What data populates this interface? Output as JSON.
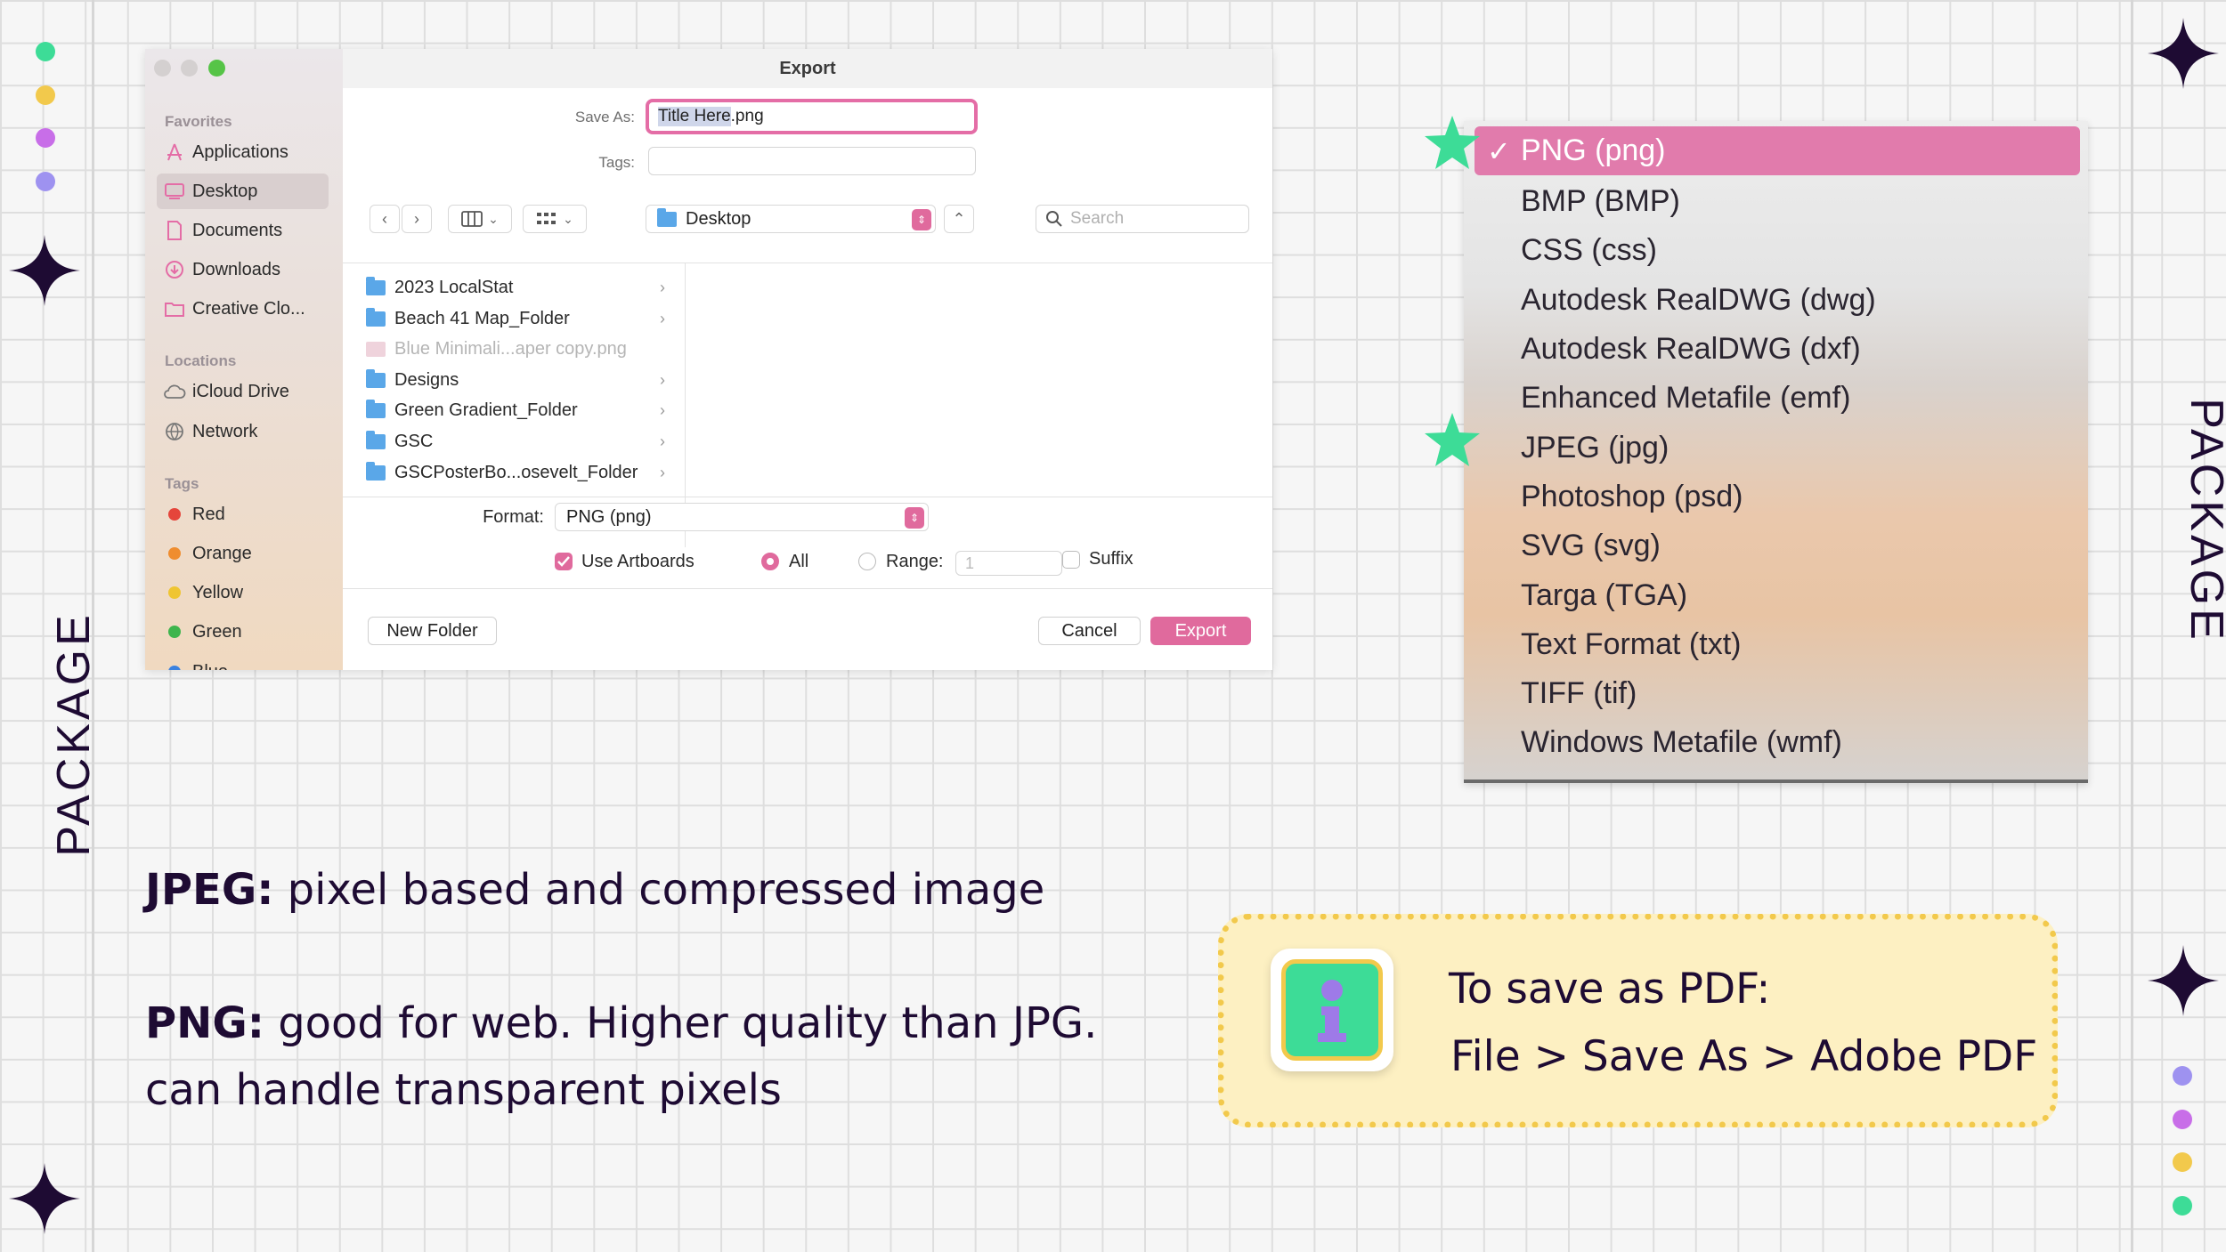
{
  "side_label": "PACKAGE",
  "dialog": {
    "title": "Export",
    "sidebar": {
      "favorites_heading": "Favorites",
      "favorites": [
        {
          "label": "Applications",
          "icon": "applications-icon"
        },
        {
          "label": "Desktop",
          "icon": "desktop-icon"
        },
        {
          "label": "Documents",
          "icon": "document-icon"
        },
        {
          "label": "Downloads",
          "icon": "download-icon"
        },
        {
          "label": "Creative Clo...",
          "icon": "folder-icon"
        }
      ],
      "locations_heading": "Locations",
      "locations": [
        {
          "label": "iCloud Drive",
          "icon": "cloud-icon"
        },
        {
          "label": "Network",
          "icon": "globe-icon"
        }
      ],
      "tags_heading": "Tags",
      "tags": [
        {
          "label": "Red",
          "color": "#e5453b"
        },
        {
          "label": "Orange",
          "color": "#ef8d2f"
        },
        {
          "label": "Yellow",
          "color": "#efc532"
        },
        {
          "label": "Green",
          "color": "#3eb54d"
        },
        {
          "label": "Blue",
          "color": "#3b82e0"
        }
      ]
    },
    "save_as_label": "Save As:",
    "save_as_highlight": "Title Here",
    "save_as_ext": ".png",
    "tags_label": "Tags:",
    "location": "Desktop",
    "search_placeholder": "Search",
    "files": [
      {
        "name": "2023 LocalStat",
        "type": "folder",
        "has_children": true
      },
      {
        "name": "Beach 41 Map_Folder",
        "type": "folder",
        "has_children": true
      },
      {
        "name": "Blue Minimali...aper copy.png",
        "type": "file",
        "has_children": false
      },
      {
        "name": "Designs",
        "type": "folder",
        "has_children": true
      },
      {
        "name": "Green Gradient_Folder",
        "type": "folder",
        "has_children": true
      },
      {
        "name": "GSC",
        "type": "folder",
        "has_children": true
      },
      {
        "name": "GSCPosterBo...osevelt_Folder",
        "type": "folder",
        "has_children": true
      }
    ],
    "format_label": "Format:",
    "format_value": "PNG (png)",
    "use_artboards": "Use Artboards",
    "use_artboards_checked": true,
    "all_label": "All",
    "range_label": "Range:",
    "range_value": "1",
    "suffix_label": "Suffix",
    "new_folder": "New Folder",
    "cancel": "Cancel",
    "export": "Export"
  },
  "format_menu": {
    "items": [
      "PNG (png)",
      "BMP (BMP)",
      "CSS (css)",
      "Autodesk RealDWG (dwg)",
      "Autodesk RealDWG (dxf)",
      "Enhanced Metafile (emf)",
      "JPEG (jpg)",
      "Photoshop (psd)",
      "SVG (svg)",
      "Targa (TGA)",
      "Text Format (txt)",
      "TIFF (tif)",
      "Windows Metafile (wmf)"
    ],
    "selected": "PNG (png)",
    "check": "✓",
    "starred": [
      "PNG (png)",
      "JPEG (jpg)"
    ],
    "accent": "#e17bac"
  },
  "notes": {
    "jpeg_term": "JPEG:",
    "jpeg_desc": " pixel based and compressed image",
    "png_term": "PNG:",
    "png_desc_1": " good for web. Higher quality than JPG.",
    "png_desc_2": "can handle transparent pixels"
  },
  "callout": {
    "line1": "To save as PDF:",
    "line2": "File > Save As > Adobe PDF",
    "icon": "info-icon"
  },
  "colors": {
    "ink": "#1e0b33",
    "pink": "#e46da6",
    "star_green": "#3ddc97",
    "callout_bg": "#fdf0c2",
    "callout_border": "#f2c94c"
  }
}
